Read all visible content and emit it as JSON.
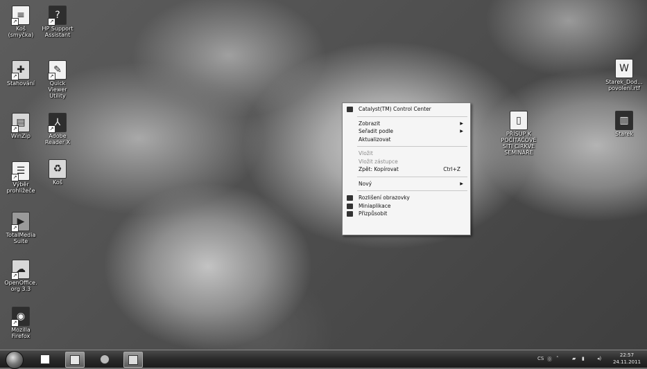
{
  "desktop_icons": [
    {
      "label": "Koš (smyčka)",
      "icon": "document-icon"
    },
    {
      "label": "HP Support Assistant",
      "icon": "support-icon"
    },
    {
      "label": "Stahování",
      "icon": "puzzle-icon"
    },
    {
      "label": "Quick Viewer Utility",
      "icon": "viewer-icon"
    },
    {
      "label": "WinZip",
      "icon": "winzip-icon"
    },
    {
      "label": "Adobe Reader X",
      "icon": "pdf-icon"
    },
    {
      "label": "Výběr prohlížeče",
      "icon": "list-icon"
    },
    {
      "label": "Koš",
      "icon": "recycle-bin-icon"
    },
    {
      "label": "TotalMedia Suite",
      "icon": "media-icon"
    },
    {
      "label": "OpenOffice.org 3.3",
      "icon": "openoffice-icon"
    },
    {
      "label": "Mozilla Firefox",
      "icon": "firefox-icon"
    },
    {
      "label": "Starek_Dod... povolení.rtf",
      "icon": "word-document-icon"
    },
    {
      "label": "Starek",
      "icon": "folder-icon"
    },
    {
      "label": "PŘÍSUP K POČÍTAČOVÉ SÍTI CÍRKVE SEMINÁŘE",
      "icon": "archive-icon"
    }
  ],
  "context_menu": {
    "items": [
      {
        "label": "Catalyst(TM) Control Center",
        "icon": "catalyst-icon"
      },
      {
        "label": "Zobrazit",
        "submenu": true
      },
      {
        "label": "Seřadit podle",
        "submenu": true
      },
      {
        "label": "Aktualizovat"
      },
      {
        "label": "Vložit",
        "disabled": true
      },
      {
        "label": "Vložit zástupce",
        "disabled": true
      },
      {
        "label": "Zpět: Kopírovat",
        "shortcut": "Ctrl+Z"
      },
      {
        "label": "Nový",
        "submenu": true
      },
      {
        "label": "Rozlišení obrazovky",
        "icon": "display-icon"
      },
      {
        "label": "Miniaplikace",
        "icon": "gadgets-icon"
      },
      {
        "label": "Přizpůsobit",
        "icon": "personalize-icon"
      }
    ]
  },
  "taskbar": {
    "language": "CS",
    "time": "22:57",
    "date": "24.11.2011",
    "pinned": [
      "media-player-icon",
      "explorer-icon",
      "firefox-icon",
      "word-icon"
    ]
  }
}
